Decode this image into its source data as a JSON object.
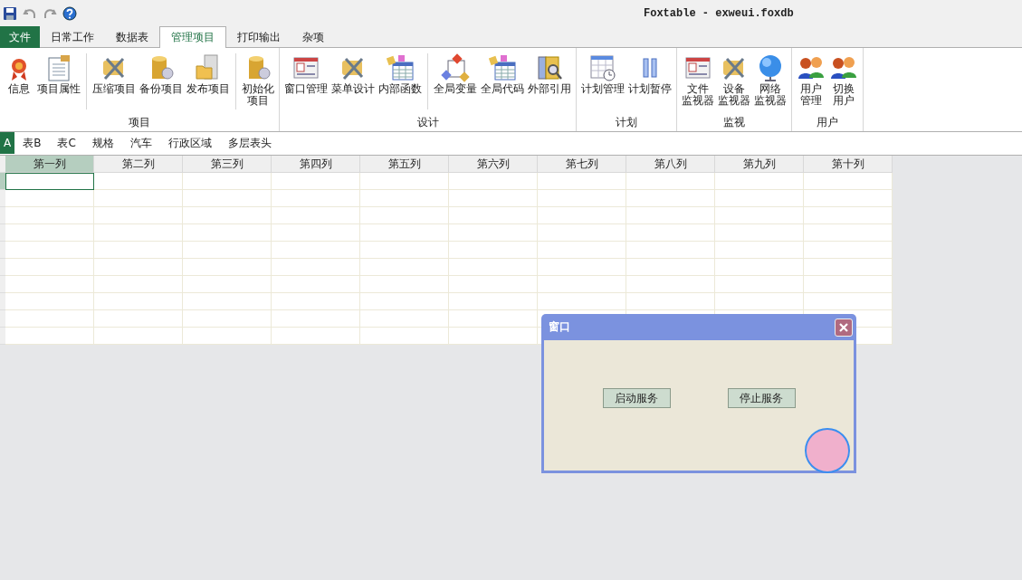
{
  "window": {
    "title": "Foxtable - exweui.foxdb"
  },
  "menu_tabs": [
    {
      "label": "文件",
      "kind": "file",
      "selected": false
    },
    {
      "label": "日常工作",
      "kind": "tab",
      "selected": false
    },
    {
      "label": "数据表",
      "kind": "tab",
      "selected": false
    },
    {
      "label": "管理项目",
      "kind": "tab",
      "selected": true
    },
    {
      "label": "打印输出",
      "kind": "tab",
      "selected": false
    },
    {
      "label": "杂项",
      "kind": "tab",
      "selected": false
    }
  ],
  "ribbon_groups": [
    {
      "label": "项目",
      "clusters": [
        [
          {
            "lines": [
              "信息"
            ],
            "kind": "award"
          },
          {
            "lines": [
              "项目属性"
            ],
            "kind": "doc"
          }
        ],
        [
          {
            "lines": [
              "压缩项目"
            ],
            "kind": "tools"
          },
          {
            "lines": [
              "备份项目"
            ],
            "kind": "db"
          },
          {
            "lines": [
              "发布项目"
            ],
            "kind": "folder"
          }
        ],
        [
          {
            "lines": [
              "初始化",
              "项目"
            ],
            "kind": "db"
          }
        ]
      ]
    },
    {
      "label": "设计",
      "clusters": [
        [
          {
            "lines": [
              "窗口管理"
            ],
            "kind": "window"
          },
          {
            "lines": [
              "菜单设计"
            ],
            "kind": "tools"
          },
          {
            "lines": [
              "内部函数"
            ],
            "kind": "table"
          }
        ],
        [
          {
            "lines": [
              "全局变量"
            ],
            "kind": "shapes"
          },
          {
            "lines": [
              "全局代码"
            ],
            "kind": "table"
          },
          {
            "lines": [
              "外部引用"
            ],
            "kind": "book"
          }
        ]
      ]
    },
    {
      "label": "计划",
      "clusters": [
        [
          {
            "lines": [
              "计划管理"
            ],
            "kind": "calendar"
          },
          {
            "lines": [
              "计划暂停"
            ],
            "kind": "pause"
          }
        ]
      ]
    },
    {
      "label": "监视",
      "clusters": [
        [
          {
            "lines": [
              "文件",
              "监视器"
            ],
            "kind": "window"
          },
          {
            "lines": [
              "设备",
              "监视器"
            ],
            "kind": "tools"
          },
          {
            "lines": [
              "网络",
              "监视器"
            ],
            "kind": "globe"
          }
        ]
      ]
    },
    {
      "label": "用户",
      "clusters": [
        [
          {
            "lines": [
              "用户",
              "管理"
            ],
            "kind": "users"
          },
          {
            "lines": [
              "切换",
              "用户"
            ],
            "kind": "users"
          }
        ]
      ]
    }
  ],
  "sheet_tabs": [
    {
      "label": "A",
      "selected": true
    },
    {
      "label": "表B",
      "selected": false
    },
    {
      "label": "表C",
      "selected": false
    },
    {
      "label": "规格",
      "selected": false
    },
    {
      "label": "汽车",
      "selected": false
    },
    {
      "label": "行政区域",
      "selected": false
    },
    {
      "label": "多层表头",
      "selected": false
    }
  ],
  "table": {
    "columns": [
      {
        "label": "第一列",
        "selected": true
      },
      {
        "label": "第二列",
        "selected": false
      },
      {
        "label": "第三列",
        "selected": false
      },
      {
        "label": "第四列",
        "selected": false
      },
      {
        "label": "第五列",
        "selected": false
      },
      {
        "label": "第六列",
        "selected": false
      },
      {
        "label": "第七列",
        "selected": false
      },
      {
        "label": "第八列",
        "selected": false
      },
      {
        "label": "第九列",
        "selected": false
      },
      {
        "label": "第十列",
        "selected": false
      }
    ]
  },
  "dialog": {
    "title": "窗口",
    "buttons": [
      "启动服务",
      "停止服务"
    ]
  }
}
